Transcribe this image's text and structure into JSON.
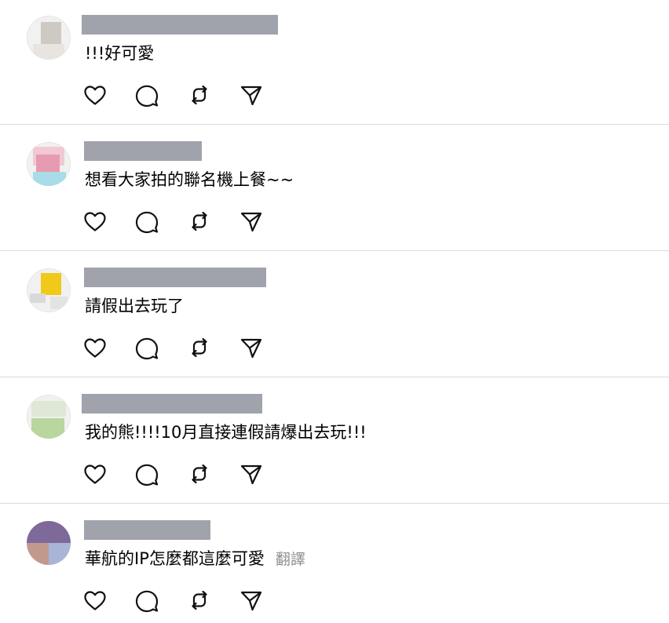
{
  "posts": [
    {
      "comment": "!!!好可愛",
      "translate": "",
      "avatar_colors": [
        "#f2f2f2",
        "#cfc9c4",
        "#e8e4e0"
      ]
    },
    {
      "comment": "想看大家拍的聯名機上餐~~",
      "translate": "",
      "avatar_colors": [
        "#f0c9d3",
        "#e79bb0",
        "#a9dbe8"
      ]
    },
    {
      "comment": "請假出去玩了",
      "translate": "",
      "avatar_colors": [
        "#f3f3f3",
        "#f0c919",
        "#d9d9d9"
      ]
    },
    {
      "comment": "我的熊!!!!10月直接連假請爆出去玩!!!",
      "translate": "",
      "avatar_colors": [
        "#edf1e9",
        "#b8d69e",
        "#dfe7d6"
      ]
    },
    {
      "comment": "華航的IP怎麼都這麼可愛",
      "translate": "翻譯",
      "avatar_colors": [
        "#7d6a9b",
        "#c29a8d",
        "#a8b5d6"
      ]
    }
  ],
  "actions": {
    "like_icon": "heart-icon",
    "comment_icon": "comment-bubble-icon",
    "repost_icon": "repost-icon",
    "share_icon": "send-icon"
  },
  "colors": {
    "username_placeholder": "#a0a3ab",
    "divider": "#dbdbdb",
    "translate": "#8e8e8e"
  }
}
